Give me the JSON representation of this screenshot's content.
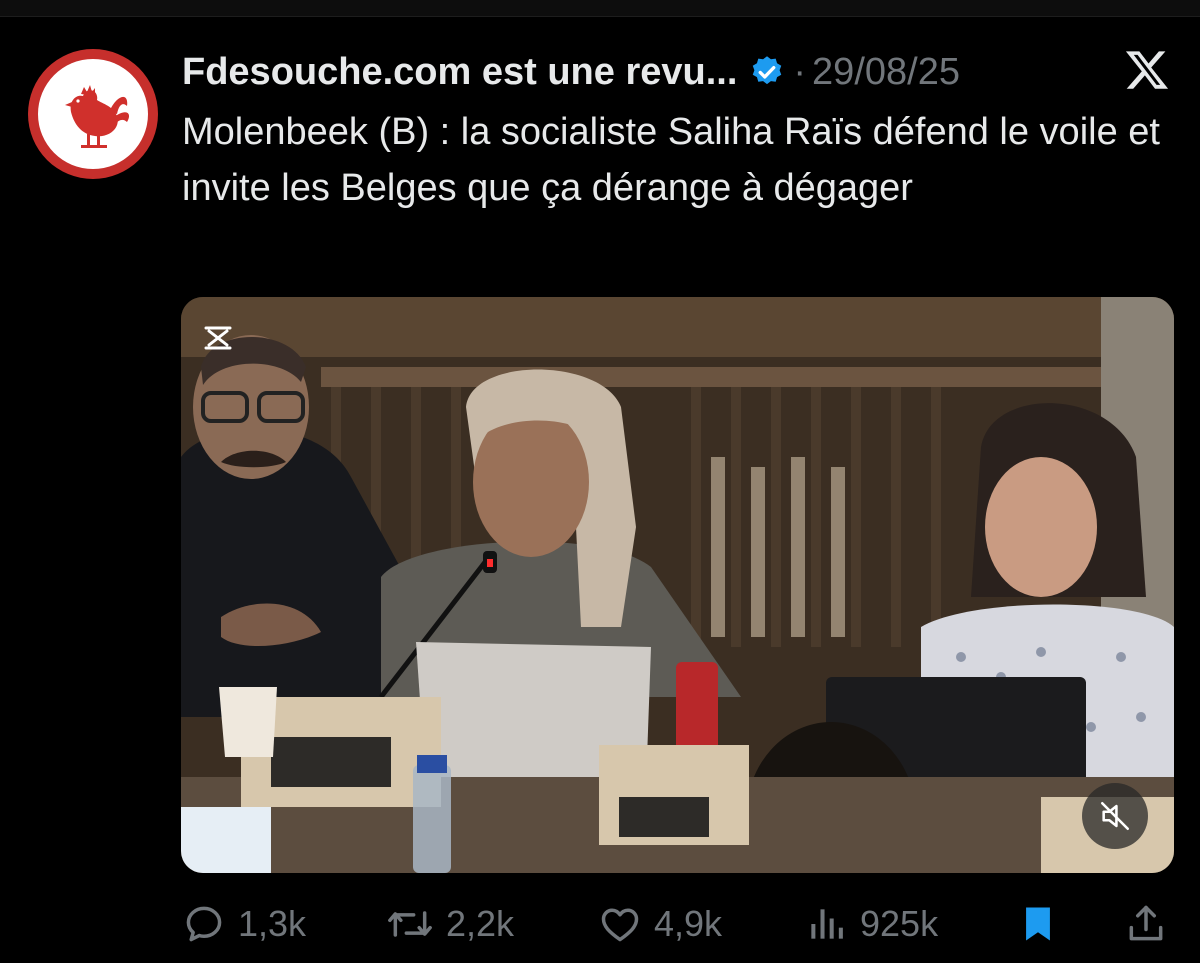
{
  "post": {
    "author": "Fdesouche.com est une revu...",
    "separator": "·",
    "date": "29/08/25",
    "text": "Molenbeek (B) : la socialiste Saliha Raïs défend le voile et invite les Belges que ça dérange à dégager",
    "verified": true
  },
  "icons": {
    "avatar": "rooster-logo-icon",
    "verified": "verified-badge-icon",
    "platform": "x-logo-icon",
    "video_watermark": "capcut-icon",
    "mute": "muted-speaker-icon",
    "reply": "reply-icon",
    "repost": "repost-icon",
    "like": "heart-icon",
    "views": "views-icon",
    "bookmark": "bookmark-icon",
    "share": "share-icon"
  },
  "actions": {
    "replies": "1,3k",
    "reposts": "2,2k",
    "likes": "4,9k",
    "views": "925k"
  },
  "colors": {
    "background": "#000000",
    "text": "#e7e9ea",
    "muted": "#71767b",
    "accent": "#1d9bf0",
    "avatar_red": "#c62f2c"
  }
}
